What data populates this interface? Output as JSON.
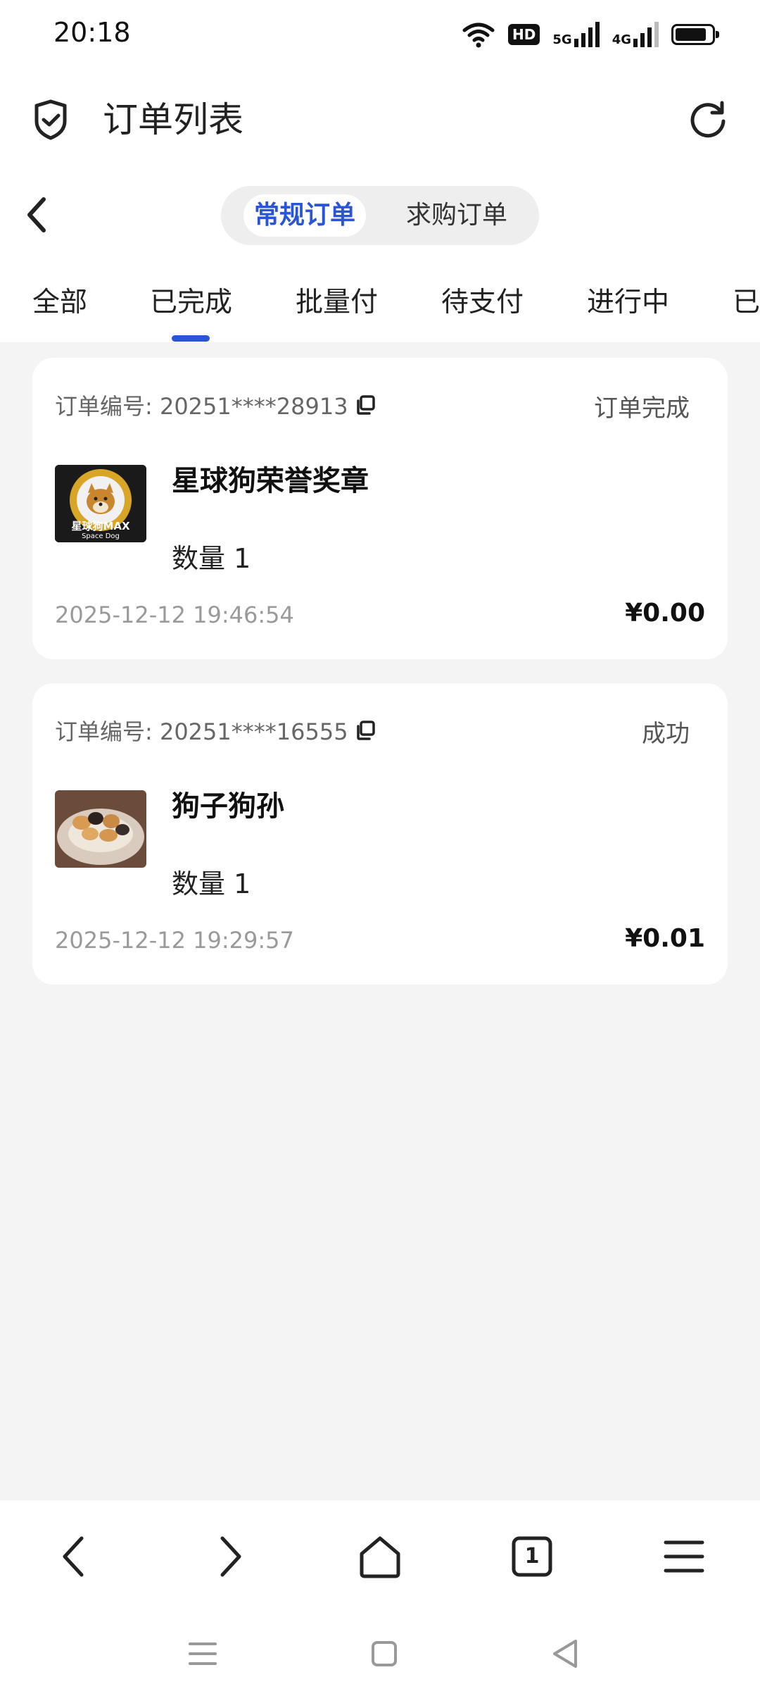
{
  "status_bar": {
    "time": "20:18",
    "hd": "HD",
    "net_5g": "5G",
    "net_4g": "4G",
    "battery_level": 0.85
  },
  "header": {
    "title": "订单列表"
  },
  "segment": {
    "active": "常规订单",
    "inactive": "求购订单"
  },
  "tabs": [
    "全部",
    "已完成",
    "批量付",
    "待支付",
    "进行中",
    "已"
  ],
  "active_tab_index": 1,
  "orders": [
    {
      "order_no_label": "订单编号: 20251****28913",
      "status": "订单完成",
      "name": "星球狗荣誉奖章",
      "quantity": "数量 1",
      "date": "2025-12-12 19:46:54",
      "price": "¥0.00",
      "thumb_text": "星球狗MAX",
      "thumb_subtext": "Space Dog"
    },
    {
      "order_no_label": "订单编号: 20251****16555",
      "status": "成功",
      "name": "狗子狗孙",
      "quantity": "数量 1",
      "date": "2025-12-12 19:29:57",
      "price": "¥0.01"
    }
  ],
  "browser_nav": {
    "tab_count": "1"
  },
  "colors": {
    "accent": "#2a55d6",
    "background": "#f4f4f4",
    "card": "#ffffff"
  }
}
